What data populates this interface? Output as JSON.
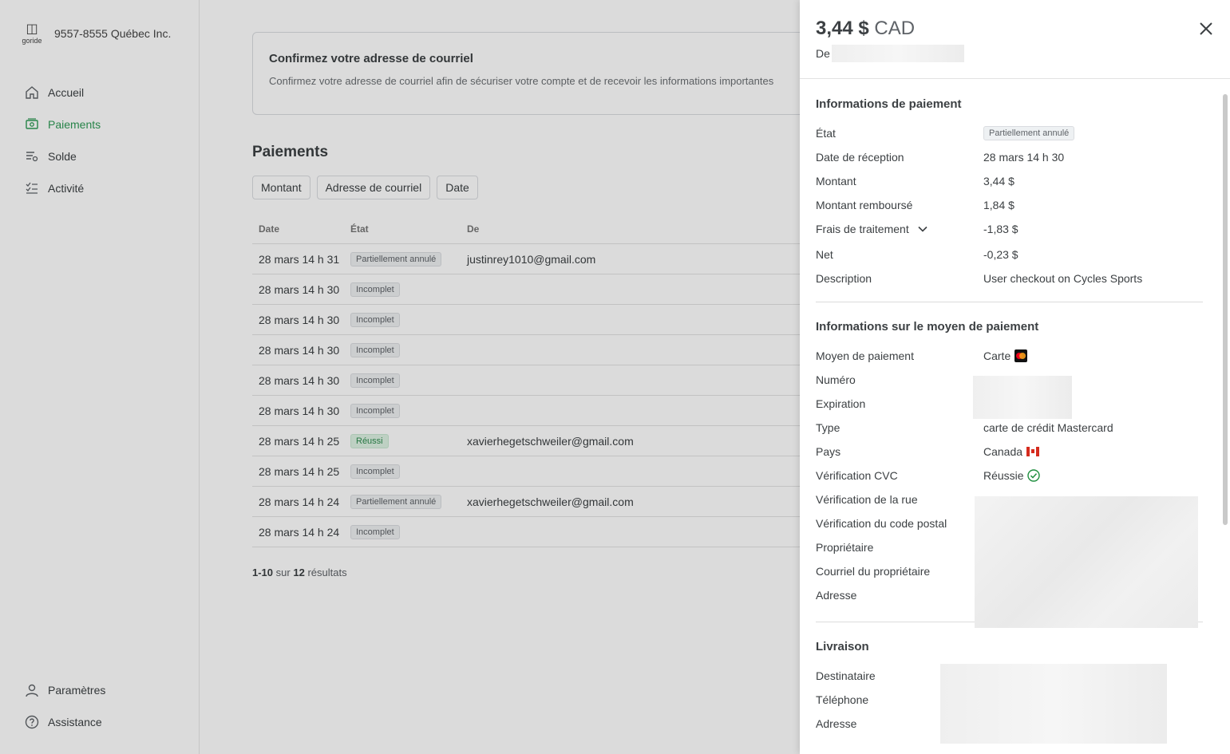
{
  "company": {
    "name": "9557-8555 Québec Inc.",
    "logo_glyph": "◫",
    "logo_word": "goride"
  },
  "sidebar": {
    "top": [
      {
        "label": "Accueil",
        "icon": "home-icon"
      },
      {
        "label": "Paiements",
        "icon": "payments-icon",
        "active": true
      },
      {
        "label": "Solde",
        "icon": "balance-icon"
      },
      {
        "label": "Activité",
        "icon": "activity-icon"
      }
    ],
    "bottom": [
      {
        "label": "Paramètres",
        "icon": "user-icon"
      },
      {
        "label": "Assistance",
        "icon": "help-icon"
      }
    ]
  },
  "banner": {
    "title": "Confirmez votre adresse de courriel",
    "text": "Confirmez votre adresse de courriel afin de sécuriser votre compte et de recevoir les informations importantes"
  },
  "payments": {
    "title": "Paiements",
    "filters": [
      "Montant",
      "Adresse de courriel",
      "Date"
    ],
    "columns": [
      "Date",
      "État",
      "De"
    ],
    "rows": [
      {
        "date": "28 mars 14 h 31",
        "state": "Partiellement annulé",
        "from": "justinrey1010@gmail.com"
      },
      {
        "date": "28 mars 14 h 30",
        "state": "Incomplet",
        "from": ""
      },
      {
        "date": "28 mars 14 h 30",
        "state": "Incomplet",
        "from": ""
      },
      {
        "date": "28 mars 14 h 30",
        "state": "Incomplet",
        "from": ""
      },
      {
        "date": "28 mars 14 h 30",
        "state": "Incomplet",
        "from": ""
      },
      {
        "date": "28 mars 14 h 30",
        "state": "Incomplet",
        "from": ""
      },
      {
        "date": "28 mars 14 h 25",
        "state": "Réussi",
        "from": "xavierhegetschweiler@gmail.com"
      },
      {
        "date": "28 mars 14 h 25",
        "state": "Incomplet",
        "from": ""
      },
      {
        "date": "28 mars 14 h 24",
        "state": "Partiellement annulé",
        "from": "xavierhegetschweiler@gmail.com"
      },
      {
        "date": "28 mars 14 h 24",
        "state": "Incomplet",
        "from": ""
      }
    ],
    "pager": {
      "range": "1-10",
      "sur": "sur",
      "total": "12",
      "suffix": "résultats"
    }
  },
  "drawer": {
    "amount": "3,44 $",
    "currency": "CAD",
    "from_label": "De",
    "payment_info": {
      "title": "Informations de paiement",
      "state_label": "État",
      "state_value": "Partiellement annulé",
      "date_label": "Date de réception",
      "date_value": "28 mars 14 h 30",
      "amount_label": "Montant",
      "amount_value": "3,44 $",
      "refunded_label": "Montant remboursé",
      "refunded_value": "1,84 $",
      "fees_label": "Frais de traitement",
      "fees_value": "-1,83 $",
      "net_label": "Net",
      "net_value": "-0,23 $",
      "desc_label": "Description",
      "desc_value": "User checkout on Cycles Sports"
    },
    "method_info": {
      "title": "Informations sur le moyen de paiement",
      "method_label": "Moyen de paiement",
      "method_value": "Carte",
      "number_label": "Numéro",
      "expiration_label": "Expiration",
      "type_label": "Type",
      "type_value": "carte de crédit Mastercard",
      "country_label": "Pays",
      "country_value": "Canada",
      "cvc_label": "Vérification CVC",
      "cvc_value": "Réussie",
      "street_label": "Vérification de la rue",
      "postal_label": "Vérification du code postal",
      "owner_label": "Propriétaire",
      "owner_email_label": "Courriel du propriétaire",
      "address_label": "Adresse"
    },
    "delivery": {
      "title": "Livraison",
      "recipient_label": "Destinataire",
      "phone_label": "Téléphone",
      "address_label": "Adresse"
    }
  },
  "colors": {
    "accent": "#2e9a55",
    "overlay": "rgba(0,0,0,0.14)"
  }
}
